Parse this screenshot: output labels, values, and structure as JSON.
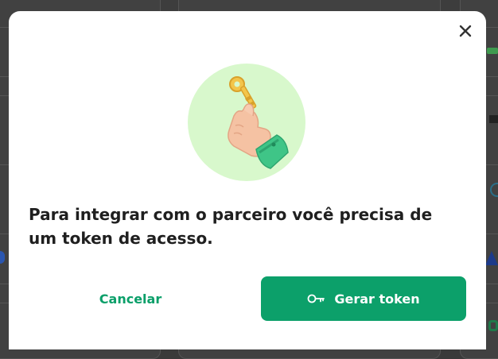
{
  "modal": {
    "message": "Para integrar com o parceiro você precisa de um token de acesso.",
    "cancel_label": "Cancelar",
    "primary_label": "Gerar token",
    "icons": {
      "close": "close-icon",
      "illustration": "hand-holding-key-illustration",
      "primary": "key-icon"
    }
  },
  "colors": {
    "accent": "#0ca06a",
    "accent_text": "#0a9f69",
    "illustration_bg": "#d8f8cc",
    "overlay": "#3d3d3d"
  }
}
